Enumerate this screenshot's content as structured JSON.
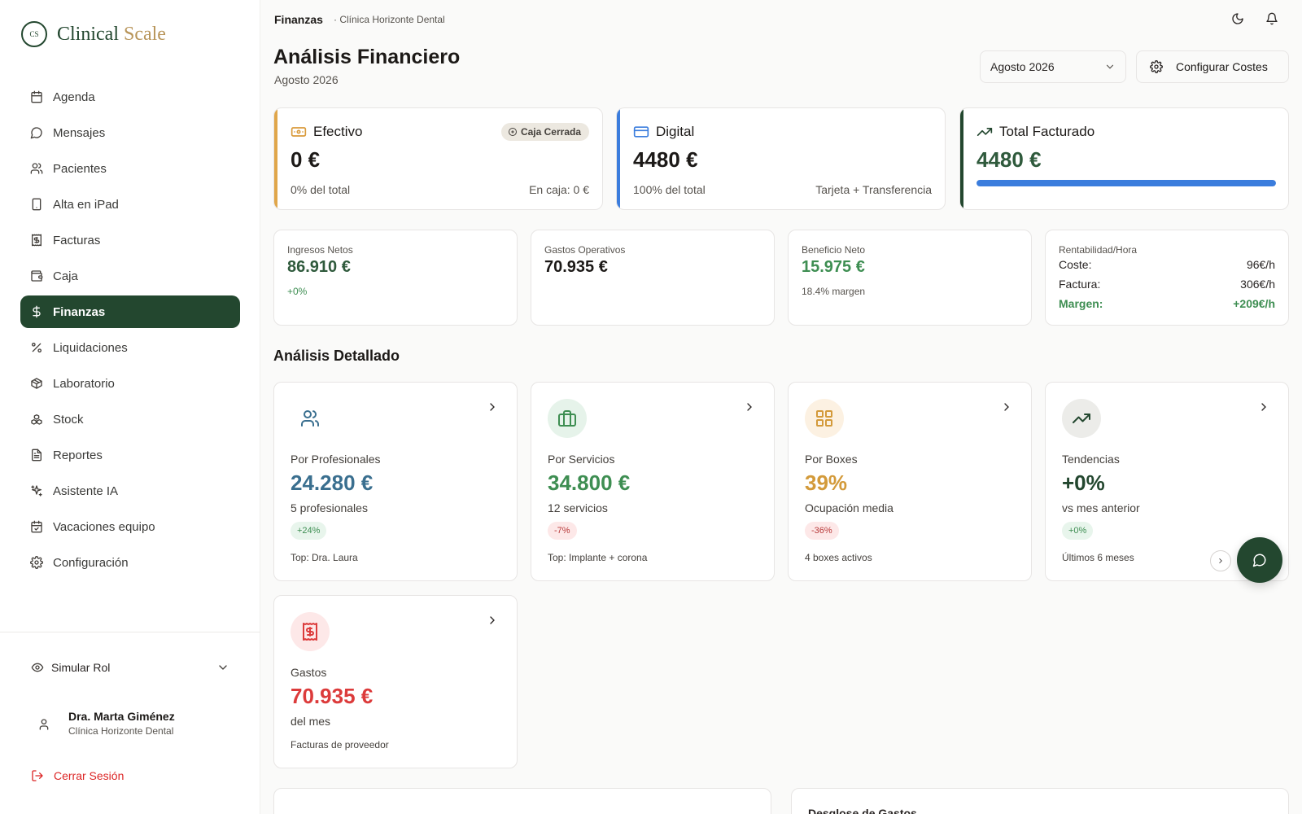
{
  "app": {
    "logo_mark": "CS",
    "logo_text_main": "Clinical",
    "logo_text_accent": "Scale"
  },
  "sidebar": {
    "items": [
      {
        "label": "Agenda",
        "icon": "calendar-icon"
      },
      {
        "label": "Mensajes",
        "icon": "message-icon"
      },
      {
        "label": "Pacientes",
        "icon": "users-icon"
      },
      {
        "label": "Alta en iPad",
        "icon": "tablet-icon"
      },
      {
        "label": "Facturas",
        "icon": "receipt-icon"
      },
      {
        "label": "Caja",
        "icon": "wallet-icon"
      },
      {
        "label": "Finanzas",
        "icon": "dollar-icon",
        "active": true
      },
      {
        "label": "Liquidaciones",
        "icon": "percent-icon"
      },
      {
        "label": "Laboratorio",
        "icon": "package-icon"
      },
      {
        "label": "Stock",
        "icon": "boxes-icon"
      },
      {
        "label": "Reportes",
        "icon": "file-text-icon"
      },
      {
        "label": "Asistente IA",
        "icon": "sparkles-icon"
      },
      {
        "label": "Vacaciones equipo",
        "icon": "calendar-check-icon"
      },
      {
        "label": "Configuración",
        "icon": "gear-icon"
      }
    ],
    "simular_rol": "Simular Rol",
    "user": {
      "name": "Dra. Marta Giménez",
      "clinic": "Clínica Horizonte Dental"
    },
    "logout": "Cerrar Sesión"
  },
  "topbar": {
    "title": "Finanzas",
    "subtitle": "· Clínica Horizonte Dental"
  },
  "header": {
    "title": "Análisis Financiero",
    "subtitle": "Agosto 2026",
    "month_select": "Agosto 2026",
    "config_button": "Configurar Costes"
  },
  "top_cards": {
    "efectivo": {
      "title": "Efectivo",
      "badge": "Caja Cerrada",
      "value": "0 €",
      "foot_left": "0% del total",
      "foot_right": "En caja: 0 €"
    },
    "digital": {
      "title": "Digital",
      "value": "4480 €",
      "foot_left": "100% del total",
      "foot_right": "Tarjeta + Transferencia"
    },
    "total": {
      "title": "Total Facturado",
      "value": "4480 €",
      "progress_percent": 100
    }
  },
  "kpis": {
    "ingresos": {
      "label": "Ingresos Netos",
      "value": "86.910 €",
      "sub": "+0%"
    },
    "gastos": {
      "label": "Gastos Operativos",
      "value": "70.935 €"
    },
    "beneficio": {
      "label": "Beneficio Neto",
      "value": "15.975 €",
      "sub": "18.4% margen"
    },
    "rentabilidad": {
      "label": "Rentabilidad/Hora",
      "coste_label": "Coste:",
      "coste_value": "96€/h",
      "factura_label": "Factura:",
      "factura_value": "306€/h",
      "margen_label": "Margen:",
      "margen_value": "+209€/h"
    }
  },
  "analysis": {
    "section_title": "Análisis Detallado",
    "cards": [
      {
        "label": "Por Profesionales",
        "value": "24.280 €",
        "sub": "5 profesionales",
        "badge": "+24%",
        "foot": "Top: Dra. Laura"
      },
      {
        "label": "Por Servicios",
        "value": "34.800 €",
        "sub": "12 servicios",
        "badge": "-7%",
        "foot": "Top: Implante + corona"
      },
      {
        "label": "Por Boxes",
        "value": "39%",
        "sub": "Ocupación media",
        "badge": "-36%",
        "foot": "4 boxes activos"
      },
      {
        "label": "Tendencias",
        "value": "+0%",
        "sub": "vs mes anterior",
        "badge": "+0%",
        "foot": "Últimos 6 meses"
      },
      {
        "label": "Gastos",
        "value": "70.935 €",
        "sub": "del mes",
        "foot": "Facturas de proveedor"
      }
    ]
  },
  "bottom": {
    "right_title": "Desglose de Gastos"
  },
  "colors": {
    "brand": "#23472f",
    "gold": "#b8955a",
    "blue": "#3b7ddd",
    "teal_blue": "#3a6f8f",
    "green": "#3e8e52",
    "amber": "#d39a3a",
    "red": "#dc3b3b"
  }
}
